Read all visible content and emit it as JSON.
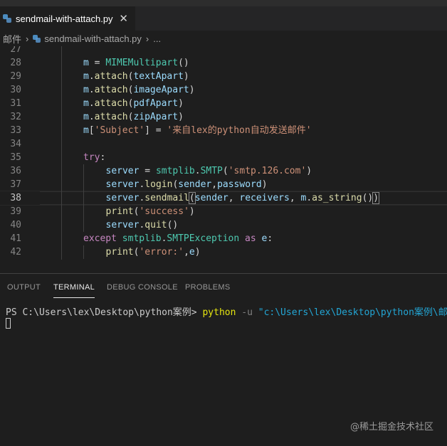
{
  "tab": {
    "filename": "sendmail-with-attach.py",
    "close_glyph": "✕"
  },
  "breadcrumb": {
    "folder": "邮件",
    "sep": "›",
    "file": "sendmail-with-attach.py",
    "tail": "..."
  },
  "editor": {
    "active_line": 38,
    "lines": [
      {
        "n": "27",
        "tokens": []
      },
      {
        "n": "28",
        "tokens": [
          [
            "t-var",
            "m"
          ],
          [
            "t-plain",
            " = "
          ],
          [
            "t-cls",
            "MIMEMultipart"
          ],
          [
            "t-plain",
            "()"
          ]
        ]
      },
      {
        "n": "29",
        "tokens": [
          [
            "t-var",
            "m"
          ],
          [
            "t-plain",
            "."
          ],
          [
            "t-fn",
            "attach"
          ],
          [
            "t-plain",
            "("
          ],
          [
            "t-var",
            "textApart"
          ],
          [
            "t-plain",
            ")"
          ]
        ]
      },
      {
        "n": "30",
        "tokens": [
          [
            "t-var",
            "m"
          ],
          [
            "t-plain",
            "."
          ],
          [
            "t-fn",
            "attach"
          ],
          [
            "t-plain",
            "("
          ],
          [
            "t-var",
            "imageApart"
          ],
          [
            "t-plain",
            ")"
          ]
        ]
      },
      {
        "n": "31",
        "tokens": [
          [
            "t-var",
            "m"
          ],
          [
            "t-plain",
            "."
          ],
          [
            "t-fn",
            "attach"
          ],
          [
            "t-plain",
            "("
          ],
          [
            "t-var",
            "pdfApart"
          ],
          [
            "t-plain",
            ")"
          ]
        ]
      },
      {
        "n": "32",
        "tokens": [
          [
            "t-var",
            "m"
          ],
          [
            "t-plain",
            "."
          ],
          [
            "t-fn",
            "attach"
          ],
          [
            "t-plain",
            "("
          ],
          [
            "t-var",
            "zipApart"
          ],
          [
            "t-plain",
            ")"
          ]
        ]
      },
      {
        "n": "33",
        "tokens": [
          [
            "t-var",
            "m"
          ],
          [
            "t-plain",
            "["
          ],
          [
            "t-str",
            "'Subject'"
          ],
          [
            "t-plain",
            "] = "
          ],
          [
            "t-str",
            "'来自lex的python自动发送邮件'"
          ]
        ]
      },
      {
        "n": "34",
        "tokens": []
      },
      {
        "n": "35",
        "tokens": [
          [
            "t-kw",
            "try"
          ],
          [
            "t-plain",
            ":"
          ]
        ]
      },
      {
        "n": "36",
        "indent": 2,
        "tokens": [
          [
            "t-var",
            "server"
          ],
          [
            "t-plain",
            " = "
          ],
          [
            "t-cls",
            "smtplib"
          ],
          [
            "t-plain",
            "."
          ],
          [
            "t-cls",
            "SMTP"
          ],
          [
            "t-plain",
            "("
          ],
          [
            "t-str",
            "'smtp.126.com'"
          ],
          [
            "t-plain",
            ")"
          ]
        ]
      },
      {
        "n": "37",
        "indent": 2,
        "tokens": [
          [
            "t-var",
            "server"
          ],
          [
            "t-plain",
            "."
          ],
          [
            "t-fn",
            "login"
          ],
          [
            "t-plain",
            "("
          ],
          [
            "t-var",
            "sender"
          ],
          [
            "t-plain",
            ","
          ],
          [
            "t-var",
            "password"
          ],
          [
            "t-plain",
            ")"
          ]
        ]
      },
      {
        "n": "38",
        "indent": 2,
        "tokens": [
          [
            "t-var",
            "server"
          ],
          [
            "t-plain",
            "."
          ],
          [
            "t-fn",
            "sendmail"
          ],
          [
            "bracket",
            "("
          ],
          [
            "t-var",
            "sender"
          ],
          [
            "t-plain",
            ", "
          ],
          [
            "t-var",
            "receivers"
          ],
          [
            "t-plain",
            ", "
          ],
          [
            "t-var",
            "m"
          ],
          [
            "t-plain",
            "."
          ],
          [
            "t-fn",
            "as_string"
          ],
          [
            "t-plain",
            "()"
          ],
          [
            "bracket",
            ")"
          ]
        ]
      },
      {
        "n": "39",
        "indent": 2,
        "tokens": [
          [
            "t-fn",
            "print"
          ],
          [
            "t-plain",
            "("
          ],
          [
            "t-str",
            "'success'"
          ],
          [
            "t-plain",
            ")"
          ]
        ]
      },
      {
        "n": "40",
        "indent": 2,
        "tokens": [
          [
            "t-var",
            "server"
          ],
          [
            "t-plain",
            "."
          ],
          [
            "t-fn",
            "quit"
          ],
          [
            "t-plain",
            "()"
          ]
        ]
      },
      {
        "n": "41",
        "tokens": [
          [
            "t-kw",
            "except"
          ],
          [
            "t-plain",
            " "
          ],
          [
            "t-cls",
            "smtplib"
          ],
          [
            "t-plain",
            "."
          ],
          [
            "t-cls",
            "SMTPException"
          ],
          [
            "t-plain",
            " "
          ],
          [
            "t-kw",
            "as"
          ],
          [
            "t-plain",
            " "
          ],
          [
            "t-var",
            "e"
          ],
          [
            "t-plain",
            ":"
          ]
        ]
      },
      {
        "n": "42",
        "indent": 2,
        "tokens": [
          [
            "t-fn",
            "print"
          ],
          [
            "t-plain",
            "("
          ],
          [
            "t-str",
            "'error:'"
          ],
          [
            "t-plain",
            ","
          ],
          [
            "t-var",
            "e"
          ],
          [
            "t-plain",
            ")"
          ]
        ]
      }
    ]
  },
  "panel": {
    "tabs": [
      {
        "label": "OUTPUT",
        "active": false
      },
      {
        "label": "TERMINAL",
        "active": true
      },
      {
        "label": "DEBUG CONSOLE",
        "active": false
      },
      {
        "label": "PROBLEMS",
        "active": false
      }
    ]
  },
  "terminal": {
    "prompt": "PS C:\\Users\\lex\\Desktop\\python案例> ",
    "command": "python",
    "flag": " -u ",
    "argument": "\"c:\\Users\\lex\\Desktop\\python案例\\邮件\\sendm"
  },
  "watermark": "@稀土掘金技术社区"
}
